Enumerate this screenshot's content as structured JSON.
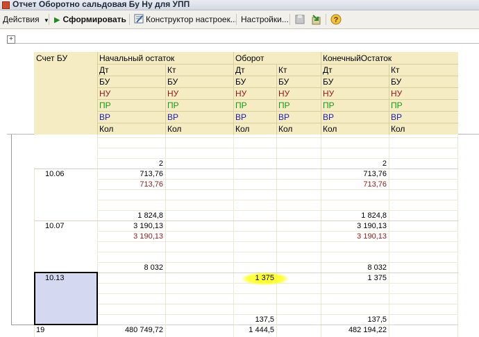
{
  "window": {
    "title": "Отчет  Оборотно сальдовая Бу Ну для УПП"
  },
  "toolbar": {
    "actions_label": "Действия",
    "generate_label": "Сформировать",
    "constructor_label": "Конструктор настроек...",
    "settings_label": "Настройки..."
  },
  "header": {
    "account": "Счет БУ",
    "groups": [
      "Начальный остаток",
      "Оборот",
      "КонечныйОстаток"
    ],
    "dt": "Дт",
    "kt": "Кт",
    "rows": [
      "БУ",
      "НУ",
      "ПР",
      "ВР",
      "Кол"
    ]
  },
  "data": {
    "group0": {
      "qty": "2"
    },
    "acc_1006": {
      "account": "10.06",
      "start_bu": "713,76",
      "start_nu": "713,76",
      "start_qty": "1 824,8",
      "end_bu": "713,76",
      "end_nu": "713,76",
      "end_qty": "1 824,8"
    },
    "acc_1007": {
      "account": "10.07",
      "start_bu": "3 190,13",
      "start_nu": "3 190,13",
      "start_qty": "8 032",
      "end_bu": "3 190,13",
      "end_nu": "3 190,13",
      "end_qty": "8 032"
    },
    "acc_1013": {
      "account": "10.13",
      "turn_bu": "1 375",
      "turn_qty": "137,5",
      "end_bu": "1 375",
      "end_qty": "137,5"
    },
    "acc_19": {
      "account": "19",
      "start_bu": "480 749,72",
      "turn_bu": "1 444,5",
      "end_bu": "482 194,22"
    }
  },
  "colors": {
    "header_bg": "#f5ecc3",
    "selected_bg": "#d4d8f0",
    "highlight": "#ffff33",
    "nu_text": "#9a1414",
    "pr_text": "#169a16",
    "vr_text": "#1c1cb0"
  }
}
